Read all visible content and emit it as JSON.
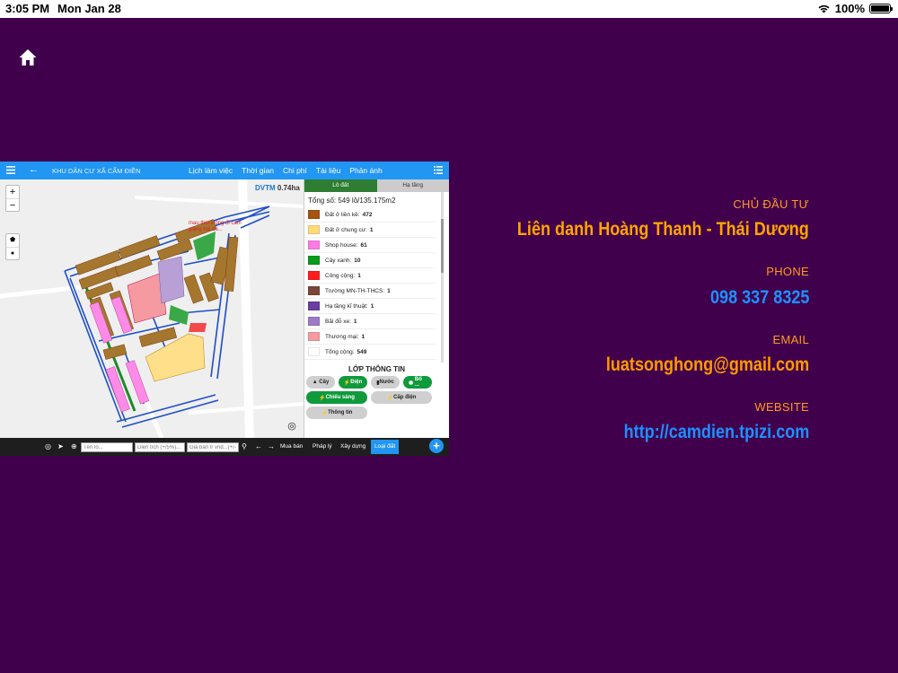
{
  "status_bar": {
    "time": "3:05 PM",
    "date": "Mon Jan 28",
    "battery": "100%"
  },
  "app": {
    "title": "KHU DÂN CƯ XÃ CẨM ĐIỀN",
    "nav": [
      "Lịch làm việc",
      "Thời gian",
      "Chi phí",
      "Tài liệu",
      "Phản ánh"
    ],
    "map": {
      "dvtm_label": "DVTM",
      "dvtm_value": "0.74ha",
      "road_label": "mau thin luong đi cam giang hai du..."
    },
    "panel": {
      "tabs": [
        "Lô đất",
        "Hạ tầng"
      ],
      "summary": "Tổng số: 549 lô/135.175m2",
      "legend": [
        {
          "label": "Đất ở liền kề:",
          "value": "472",
          "color": "#a5540f"
        },
        {
          "label": "Đất ở chung cư:",
          "value": "1",
          "color": "#ffd97a"
        },
        {
          "label": "Shop house:",
          "value": "61",
          "color": "#ff7ae6"
        },
        {
          "label": "Cây xanh:",
          "value": "10",
          "color": "#0a9a1c"
        },
        {
          "label": "Công cộng:",
          "value": "1",
          "color": "#ff1c1c"
        },
        {
          "label": "Trường MN-TH-THCS:",
          "value": "1",
          "color": "#7a4636"
        },
        {
          "label": "Hạ tầng kĩ thuật:",
          "value": "1",
          "color": "#6a3fa0"
        },
        {
          "label": "Bãi đỗ xe:",
          "value": "1",
          "color": "#9c7ac8"
        },
        {
          "label": "Thương mại:",
          "value": "1",
          "color": "#f59aa0"
        },
        {
          "label": "Tổng cộng:",
          "value": "549",
          "color": "#ffffff"
        }
      ],
      "info_title": "LỚP THÔNG TIN",
      "pills": [
        "Cây",
        "Điện",
        "Nước",
        "Bố ...",
        "Chiếu sáng",
        "Cấp điện",
        "Thông tin"
      ]
    },
    "bottom": {
      "name_placeholder": "Tên lô...",
      "area_placeholder": "Diện tích (+/5%)...",
      "price_placeholder": "Giá bán tr vnđ...(+/-",
      "tabs": [
        "Mua bán",
        "Pháp lý",
        "Xây dựng",
        "Loại đất"
      ]
    }
  },
  "contact": {
    "investor_label": "CHỦ ĐẦU TƯ",
    "investor": "Liên danh Hoàng Thanh - Thái Dương",
    "phone_label": "PHONE",
    "phone": "098 337 8325",
    "email_label": "EMAIL",
    "email": "luatsonghong@gmail.com",
    "website_label": "WEBSITE",
    "website": "http://camdien.tpizi.com"
  },
  "colors": {
    "background": "#41004c",
    "label_orange": "#ff9a21",
    "investor_orange": "#ffa500",
    "phone_blue": "#1e90ff",
    "email_orange": "#ff9a00",
    "website_blue": "#1e90ff"
  }
}
